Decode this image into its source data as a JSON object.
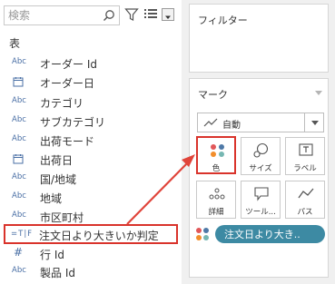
{
  "left_panel": {
    "search_placeholder": "検索",
    "section_title": "表",
    "fields": [
      {
        "type_icon": "abc-icon",
        "type_label": "Abc",
        "name": "オーダー Id"
      },
      {
        "type_icon": "calendar-icon",
        "type_label": "",
        "name": "オーダー日"
      },
      {
        "type_icon": "abc-icon",
        "type_label": "Abc",
        "name": "カテゴリ"
      },
      {
        "type_icon": "abc-icon",
        "type_label": "Abc",
        "name": "サブカテゴリ"
      },
      {
        "type_icon": "abc-icon",
        "type_label": "Abc",
        "name": "出荷モード"
      },
      {
        "type_icon": "calendar-icon",
        "type_label": "",
        "name": "出荷日"
      },
      {
        "type_icon": "abc-icon",
        "type_label": "Abc",
        "name": "国/地域"
      },
      {
        "type_icon": "abc-icon",
        "type_label": "Abc",
        "name": "地域"
      },
      {
        "type_icon": "abc-icon",
        "type_label": "Abc",
        "name": "市区町村"
      },
      {
        "type_icon": "boolean-icon",
        "type_label": "=T|F",
        "name": "注文日より大きいか判定"
      },
      {
        "type_icon": "number-icon",
        "type_label": "#",
        "name": "行 Id"
      },
      {
        "type_icon": "abc-icon",
        "type_label": "Abc",
        "name": "製品 Id"
      }
    ]
  },
  "right_panel": {
    "filters_title": "フィルター",
    "marks_title": "マーク",
    "mark_type": "自動",
    "mark_buttons": [
      {
        "label": "色",
        "icon": "color-dots-icon"
      },
      {
        "label": "サイズ",
        "icon": "size-icon"
      },
      {
        "label": "ラベル",
        "icon": "label-icon"
      },
      {
        "label": "詳細",
        "icon": "detail-icon"
      },
      {
        "label": "ツール...",
        "icon": "tooltip-icon"
      },
      {
        "label": "パス",
        "icon": "path-icon"
      }
    ],
    "color_pill": "注文日より大き.."
  },
  "colors": {
    "highlight_red": "#d9332b",
    "pill_teal": "#3d8aa3",
    "dot_red": "#e15759",
    "dot_blue": "#4e79a7",
    "dot_orange": "#f28e2b",
    "dot_teal": "#76b7b2"
  }
}
